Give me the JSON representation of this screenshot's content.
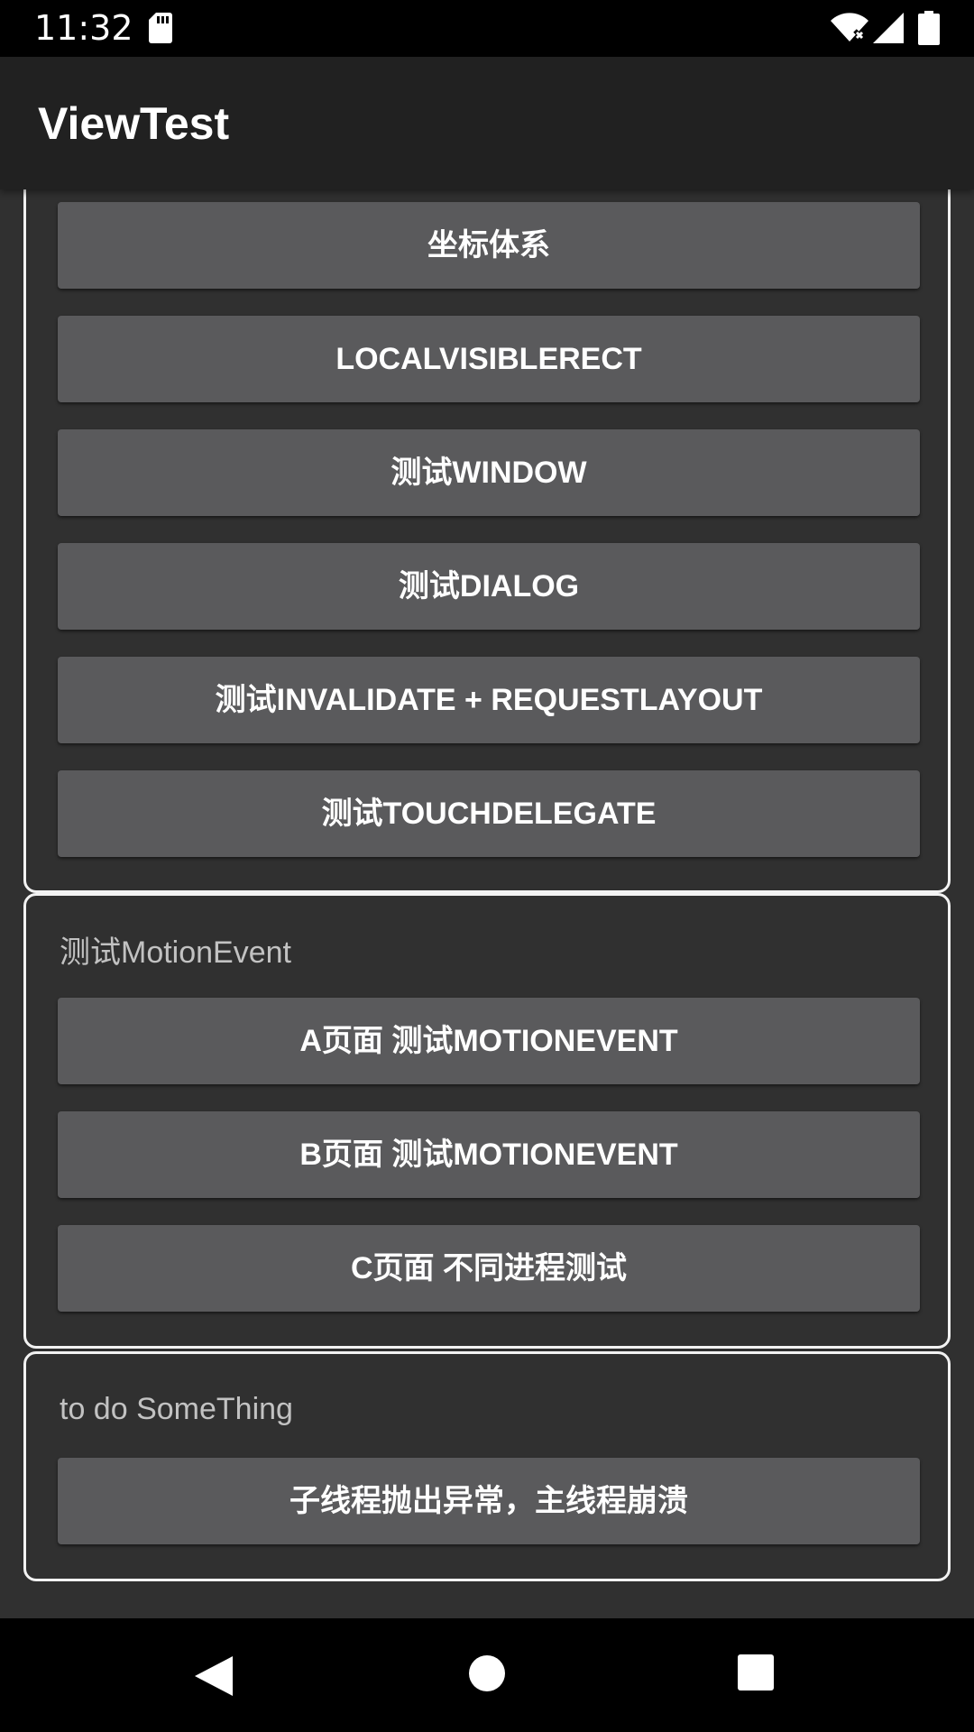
{
  "status_bar": {
    "time": "11:32",
    "icons": [
      "sd-card-icon",
      "wifi-icon",
      "signal-icon",
      "battery-icon"
    ]
  },
  "app_bar": {
    "title": "ViewTest"
  },
  "groups": [
    {
      "title": "",
      "buttons": [
        "坐标体系",
        "LOCALVISIBLERECT",
        "测试WINDOW",
        "测试DIALOG",
        "测试INVALIDATE + REQUESTLAYOUT",
        "测试TOUCHDELEGATE"
      ]
    },
    {
      "title": "测试MotionEvent",
      "buttons": [
        "A页面 测试MOTIONEVENT",
        "B页面 测试MOTIONEVENT",
        "C页面 不同进程测试"
      ]
    },
    {
      "title": "to do SomeThing",
      "buttons": [
        "子线程抛出异常，主线程崩溃"
      ]
    }
  ],
  "nav_bar": {
    "icons": [
      "back-icon",
      "home-icon",
      "recents-icon"
    ]
  },
  "colors": {
    "status_bar": "#000000",
    "app_bar": "#212121",
    "background": "#303030",
    "button": "#5a5a5c",
    "group_border": "#f2f2f2"
  }
}
